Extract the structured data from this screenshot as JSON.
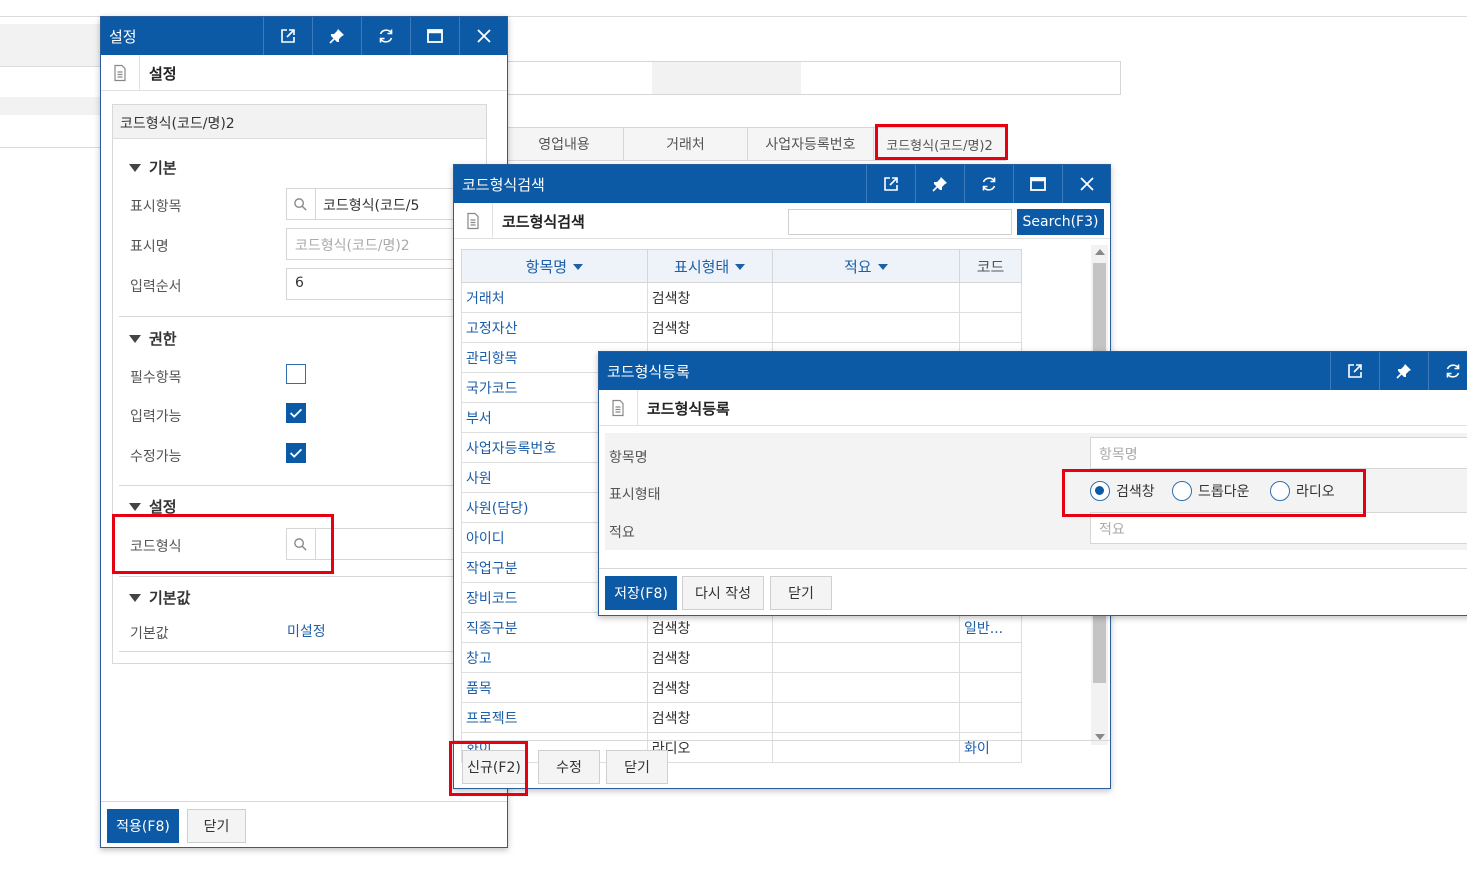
{
  "background": {
    "columns": [
      "영업내용",
      "거래처",
      "사업자등록번호",
      "코드형식(코드/명)2"
    ]
  },
  "settings_window": {
    "title": "설정",
    "subtitle": "설정",
    "section_caption": "코드형식(코드/명)2",
    "basic": {
      "header": "기본",
      "display_item_label": "표시항목",
      "display_item_value": "코드형식(코드/5",
      "display_name_label": "표시명",
      "display_name_placeholder": "코드형식(코드/명)2",
      "input_order_label": "입력순서",
      "input_order_value": "6"
    },
    "permission": {
      "header": "권한",
      "required_label": "필수항목",
      "required_checked": false,
      "input_label": "입력가능",
      "input_checked": true,
      "edit_label": "수정가능",
      "edit_checked": true
    },
    "config": {
      "header": "설정",
      "code_format_label": "코드형식"
    },
    "default": {
      "header": "기본값",
      "label": "기본값",
      "value": "미설정"
    },
    "buttons": {
      "apply": "적용(F8)",
      "close": "닫기"
    }
  },
  "search_window": {
    "title": "코드형식검색",
    "subtitle": "코드형식검색",
    "search_value": "",
    "search_button": "Search(F3)",
    "columns": [
      "항목명",
      "표시형태",
      "적요",
      "코드"
    ],
    "rows": [
      {
        "name": "거래처",
        "type": "검색창",
        "desc": "",
        "code": ""
      },
      {
        "name": "고정자산",
        "type": "검색창",
        "desc": "",
        "code": ""
      },
      {
        "name": "관리항목",
        "type": "검색창",
        "desc": "",
        "code": ""
      },
      {
        "name": "국가코드",
        "type": "",
        "desc": "",
        "code": ""
      },
      {
        "name": "부서",
        "type": "",
        "desc": "",
        "code": ""
      },
      {
        "name": "사업자등록번호",
        "type": "",
        "desc": "",
        "code": ""
      },
      {
        "name": "사원",
        "type": "",
        "desc": "",
        "code": ""
      },
      {
        "name": "사원(담당)",
        "type": "",
        "desc": "",
        "code": ""
      },
      {
        "name": "아이디",
        "type": "",
        "desc": "",
        "code": ""
      },
      {
        "name": "작업구분",
        "type": "",
        "desc": "",
        "code": ""
      },
      {
        "name": "장비코드",
        "type": "",
        "desc": "",
        "code": ""
      },
      {
        "name": "직종구분",
        "type": "검색창",
        "desc": "",
        "code": "일반..."
      },
      {
        "name": "창고",
        "type": "검색창",
        "desc": "",
        "code": ""
      },
      {
        "name": "품목",
        "type": "검색창",
        "desc": "",
        "code": ""
      },
      {
        "name": "프로젝트",
        "type": "검색창",
        "desc": "",
        "code": ""
      },
      {
        "name": "화이",
        "type": "라디오",
        "desc": "",
        "code": "화이"
      }
    ],
    "buttons": {
      "new": "신규(F2)",
      "edit": "수정",
      "close": "닫기"
    }
  },
  "register_window": {
    "title": "코드형식등록",
    "subtitle": "코드형식등록",
    "item_name_label": "항목명",
    "item_name_placeholder": "항목명",
    "display_type_label": "표시형태",
    "display_type_options": [
      "검색창",
      "드롭다운",
      "라디오"
    ],
    "display_type_selected": "검색창",
    "desc_label": "적요",
    "desc_placeholder": "적요",
    "buttons": {
      "save": "저장(F8)",
      "reset": "다시 작성",
      "close": "닫기"
    }
  }
}
